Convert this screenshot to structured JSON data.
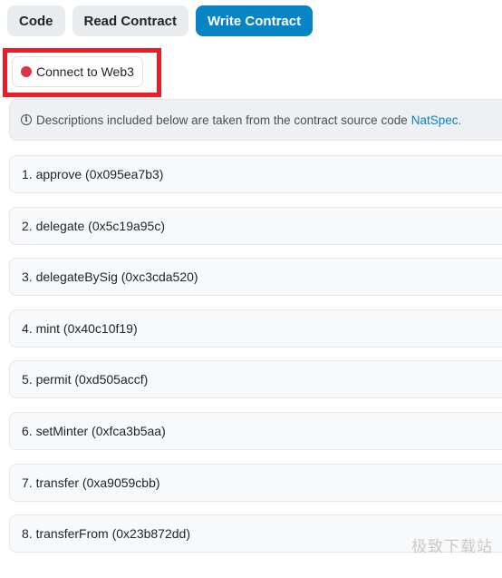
{
  "tabs": [
    {
      "label": "Code",
      "active": false
    },
    {
      "label": "Read Contract",
      "active": false
    },
    {
      "label": "Write Contract",
      "active": true
    }
  ],
  "connect": {
    "label": "Connect to Web3",
    "status_color": "#dc3545",
    "highlight_color": "#ee1c25"
  },
  "info": {
    "text": "Descriptions included below are taken from the contract source code",
    "link": "NatSpec."
  },
  "functions": [
    {
      "label": "1. approve (0x095ea7b3)"
    },
    {
      "label": "2. delegate (0x5c19a95c)"
    },
    {
      "label": "3. delegateBySig (0xc3cda520)"
    },
    {
      "label": "4. mint (0x40c10f19)"
    },
    {
      "label": "5. permit (0xd505accf)"
    },
    {
      "label": "6. setMinter (0xfca3b5aa)"
    },
    {
      "label": "7. transfer (0xa9059cbb)"
    },
    {
      "label": "8. transferFrom (0x23b872dd)"
    }
  ],
  "colors": {
    "accent": "#0784c3",
    "tab_bg": "#e9ecef"
  },
  "watermark": "极致下载站"
}
